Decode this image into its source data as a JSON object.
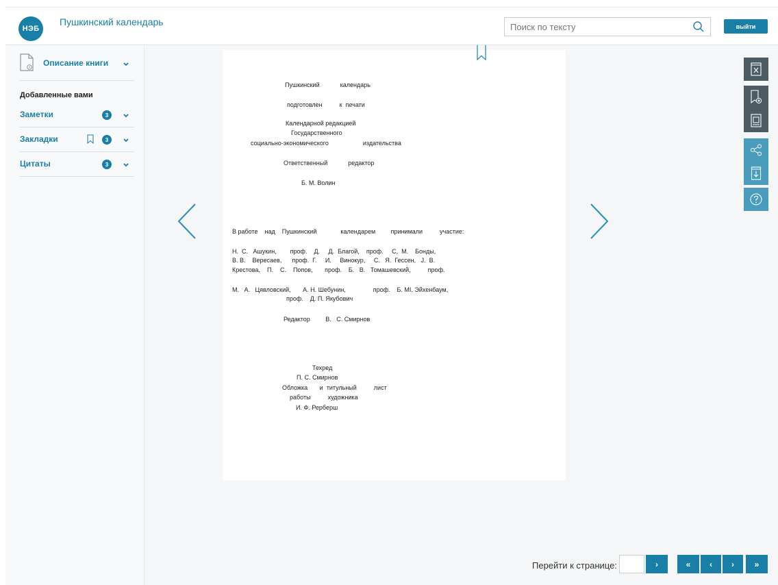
{
  "header": {
    "logo_text": "НЭБ",
    "title": "Пушкинский календарь",
    "search_placeholder": "Поиск по тексту",
    "logout_label": "выйти",
    "accent_color": "#1a7fa6"
  },
  "sidebar": {
    "description_label": "Описание книги",
    "added_label": "Добавленные вами",
    "items": [
      {
        "label": "Заметки",
        "count": "3"
      },
      {
        "label": "Закладки",
        "count": "3"
      },
      {
        "label": "Цитаты",
        "count": "3"
      }
    ]
  },
  "page": {
    "lines": [
      "Пушкинский            календарь",
      "подготовлен          к  печати",
      "Календарной редакцией",
      "Государственного",
      "социально-экономического                    издательства",
      "Ответственный            редактор",
      "Б. М. Волин",
      "В работе    над    Пушкинский              календарем         принимали          участие:",
      "Н.  С.   Ашукин,        проф.    Д.     Д.  Благой,    проф.     С,  М.    Бонды,",
      "В. В.    Вересаев,      проф.  Г.     И.     Винокур,     С.   Я.  Гессен,   J.  В.",
      "Крестова,    П.    С.    Попов,       проф.    Б.   В.   Томашевский,          проф.",
      "М.   А.   Цявловский,       А. Н. Шебунин,                проф.    Б. МI. Эйхенбаум,",
      "проф.    Д. П. Якубович",
      "Редактор         В.   С. Смирнов",
      "Техред",
      "П. С. Смирнов",
      "Обложка       и  титульный          лист",
      "работы          художника",
      "И. Ф. Рерберш"
    ]
  },
  "toolbar": {
    "icons": [
      "close-book-icon",
      "add-bookmark-icon",
      "add-quote-icon",
      "share-icon",
      "download-icon",
      "help-icon"
    ]
  },
  "pager": {
    "goto_label": "Перейти к странице:",
    "go_symbol": "›",
    "first_symbol": "«",
    "prev_symbol": "‹",
    "next_symbol": "›",
    "last_symbol": "»"
  }
}
